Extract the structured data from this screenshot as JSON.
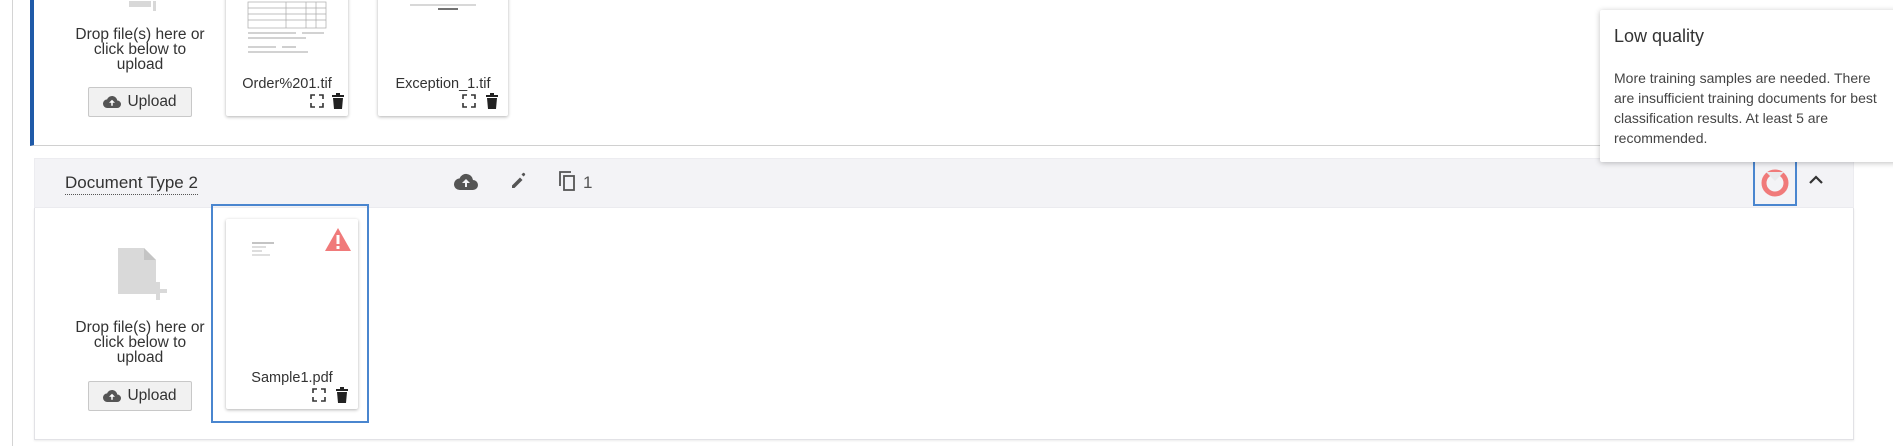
{
  "section1": {
    "drop_text": "Drop file(s) here or click below to upload",
    "upload_label": "Upload",
    "cards": [
      {
        "name": "Order%201.tif"
      },
      {
        "name": "Exception_1.tif"
      }
    ]
  },
  "section2": {
    "title": "Document Type 2",
    "doc_count": "1",
    "drop_text": "Drop file(s) here or click below to upload",
    "upload_label": "Upload",
    "cards": [
      {
        "name": "Sample1.pdf",
        "warning": true
      }
    ]
  },
  "tooltip": {
    "title": "Low quality",
    "body": "More training samples are needed. There are insufficient training documents for best classification results. At least 5 are recommended."
  },
  "colors": {
    "accent_blue": "#4a86cf",
    "left_bar": "#1f5aa8",
    "warning_red": "#f07a7a"
  },
  "icons": [
    "upload-icon",
    "edit-icon",
    "copy-icon",
    "chevron-up-icon",
    "quality-indicator-icon",
    "expand-icon",
    "trash-icon",
    "warning-icon",
    "file-add-icon"
  ]
}
